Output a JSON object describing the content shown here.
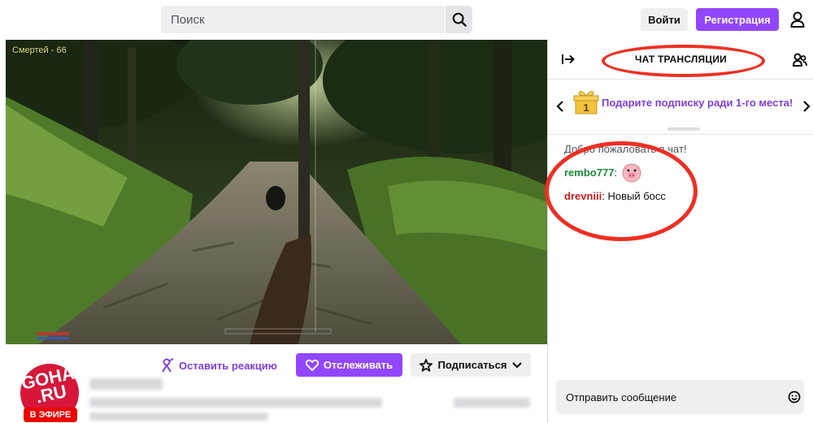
{
  "topbar": {
    "search_placeholder": "Поиск",
    "login_label": "Войти",
    "register_label": "Регистрация"
  },
  "video": {
    "overlay_text": "Смертей - 66"
  },
  "channel": {
    "react_label": "Оставить реакцию",
    "follow_label": "Отслеживать",
    "subscribe_label": "Подписаться",
    "avatar_text_line1": "GOHA",
    "avatar_text_line2": ".RU",
    "live_badge": "В ЭФИРЕ"
  },
  "chat": {
    "title": "ЧАТ ТРАНСЛЯЦИИ",
    "promo_badge": "1",
    "promo_text": "Подарите подписку ради 1-го места!",
    "welcome": "Добро пожаловать в чат!",
    "messages": [
      {
        "user": "rembo777",
        "separator": ":",
        "text": "",
        "emote": "pig-emote"
      },
      {
        "user": "drevniii",
        "separator": ":",
        "text": " Новый босс",
        "emote": ""
      }
    ],
    "input_placeholder": "Отправить сообщение"
  },
  "colors": {
    "brand_purple": "#9147ff",
    "annotation_red": "#ee2f22",
    "live_red": "#eb0400"
  }
}
